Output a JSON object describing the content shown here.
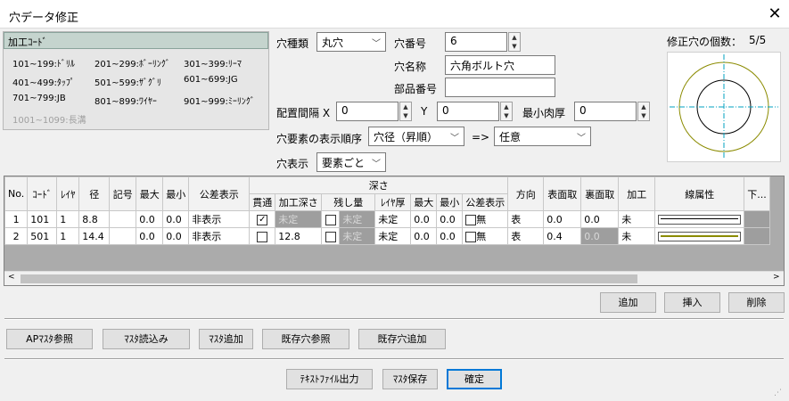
{
  "window": {
    "title": "穴データ修正",
    "close": "✕"
  },
  "proc": {
    "header": "加工ｺｰﾄﾞ",
    "items": [
      "101~199:ﾄﾞﾘﾙ",
      "201~299:ﾎﾞｰﾘﾝｸﾞ",
      "301~399:ﾘｰﾏ",
      "401~499:ﾀｯﾌﾟ",
      "501~599:ｻﾞｸﾞﾘ",
      "601~699:JG",
      "701~799:JB",
      "801~899:ﾜｲﾔｰ",
      "901~999:ﾐｰﾘﾝｸﾞ"
    ],
    "disabled_item": "1001~1099:長溝"
  },
  "form": {
    "hole_type_label": "穴種類",
    "hole_type_value": "丸穴",
    "hole_no_label": "穴番号",
    "hole_no_value": "6",
    "hole_name_label": "穴名称",
    "hole_name_value": "六角ボルト穴",
    "part_no_label": "部品番号",
    "part_no_value": "",
    "pitch_x_label": "配置間隔 X",
    "pitch_x_value": "0",
    "pitch_y_label": "Y",
    "pitch_y_value": "0",
    "min_thick_label": "最小肉厚",
    "min_thick_value": "0",
    "order_label": "穴要素の表示順序",
    "order_value": "穴径（昇順）",
    "arrow": "=>",
    "order2_value": "任意",
    "display_label": "穴表示",
    "display_value": "要素ごと",
    "count_label": "修正穴の個数：",
    "count_value": "5/5"
  },
  "table": {
    "headers": {
      "no": "No.",
      "code": "ｺｰﾄﾞ",
      "layer": "ﾚｲﾔ",
      "dia": "径",
      "sym": "記号",
      "max": "最大",
      "min": "最小",
      "tol": "公差表示",
      "depth": "深さ",
      "thru": "貫通",
      "mdepth": "加工深さ",
      "remain": "残し量",
      "lthick": "ﾚｲﾔ厚",
      "dmax": "最大",
      "dmin": "最小",
      "dtol": "公差表示",
      "dir": "方向",
      "face": "表面取",
      "back": "裏面取",
      "proc": "加工",
      "line": "線属性",
      "more": "下..."
    },
    "rows": [
      {
        "no": "1",
        "code": "101",
        "layer": "1",
        "dia": "8.8",
        "sym": "",
        "max": "0.0",
        "min": "0.0",
        "tol": "非表示",
        "thru": "✓",
        "mdepth": "未定",
        "remain_cb": "",
        "remain": "未定",
        "lthick": "未定",
        "dmax": "0.0",
        "dmin": "0.0",
        "dtol": "無",
        "dir": "表",
        "face": "0.0",
        "back": "0.0",
        "proc": "未",
        "line_color": "#000000"
      },
      {
        "no": "2",
        "code": "501",
        "layer": "1",
        "dia": "14.4",
        "sym": "",
        "max": "0.0",
        "min": "0.0",
        "tol": "非表示",
        "thru": "",
        "mdepth": "12.8",
        "remain_cb": "",
        "remain": "未定",
        "lthick": "未定",
        "dmax": "0.0",
        "dmin": "0.0",
        "dtol": "無",
        "dir": "表",
        "face": "0.4",
        "back": "0.0",
        "proc": "未",
        "line_color": "#8b8b00"
      }
    ]
  },
  "buttons": {
    "add": "追加",
    "insert": "挿入",
    "delete": "削除",
    "ap_ref": "APﾏｽﾀ参照",
    "master_load": "ﾏｽﾀ読込み",
    "master_add": "ﾏｽﾀ追加",
    "existing_ref": "既存穴参照",
    "existing_add": "既存穴追加",
    "text_out": "ﾃｷｽﾄﾌｧｲﾙ出力",
    "master_save": "ﾏｽﾀ保存",
    "ok": "確定"
  },
  "colors": {
    "accent": "#0078d7",
    "proc_header": "#c5d4ce",
    "circle_outer": "#8b8b00",
    "crosshair": "#00a0c0"
  }
}
